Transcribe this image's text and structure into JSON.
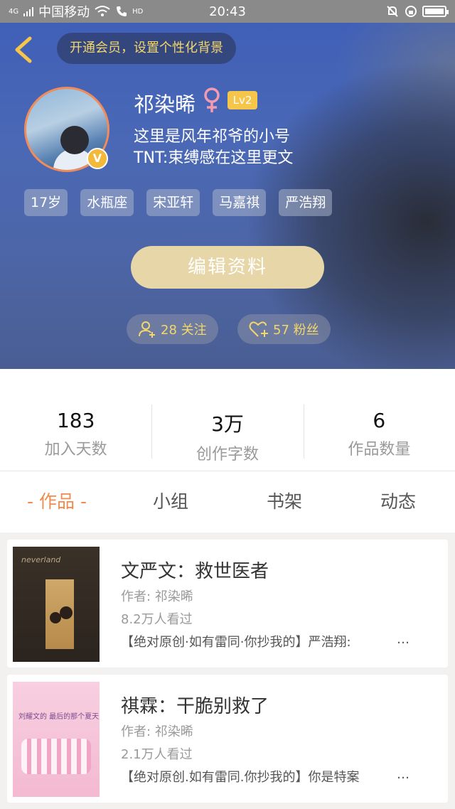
{
  "status_bar": {
    "carrier": "中国移动",
    "network": "4G",
    "hd": "HD",
    "time": "20:43"
  },
  "header": {
    "vip_banner": "开通会员，设置个性化背景",
    "username": "祁染晞",
    "level": "Lv2",
    "bio_line1": "这里是风年祁爷的小号",
    "bio_line2": "TNT:束缚感在这里更文",
    "avatar_badge": "V",
    "tags": [
      "17岁",
      "水瓶座",
      "宋亚轩",
      "马嘉祺",
      "严浩翔"
    ],
    "edit_button": "编辑资料",
    "following": "28 关注",
    "followers": "57 粉丝"
  },
  "stats": [
    {
      "value": "183",
      "label": "加入天数"
    },
    {
      "value": "3万",
      "label": "创作字数"
    },
    {
      "value": "6",
      "label": "作品数量"
    }
  ],
  "tabs": [
    "- 作品 -",
    "小组",
    "书架",
    "动态"
  ],
  "works": [
    {
      "title": "文严文：救世医者",
      "author": "作者: 祁染晞",
      "views": "8.2万人看过",
      "desc": "【绝对原创·如有雷同·你抄我的】严浩翔:",
      "cover_text": "neverland"
    },
    {
      "title": "祺霖：干脆别救了",
      "author": "作者: 祁染晞",
      "views": "2.1万人看过",
      "desc": "【绝对原创.如有雷同.你抄我的】你是特案",
      "cover_text": "刘耀文的 最后的那个夏天"
    }
  ],
  "colors": {
    "accent": "#f08b4d",
    "gold": "#f4d76a",
    "level_badge": "#f6c64a",
    "edit_button": "#e7d6a8"
  }
}
